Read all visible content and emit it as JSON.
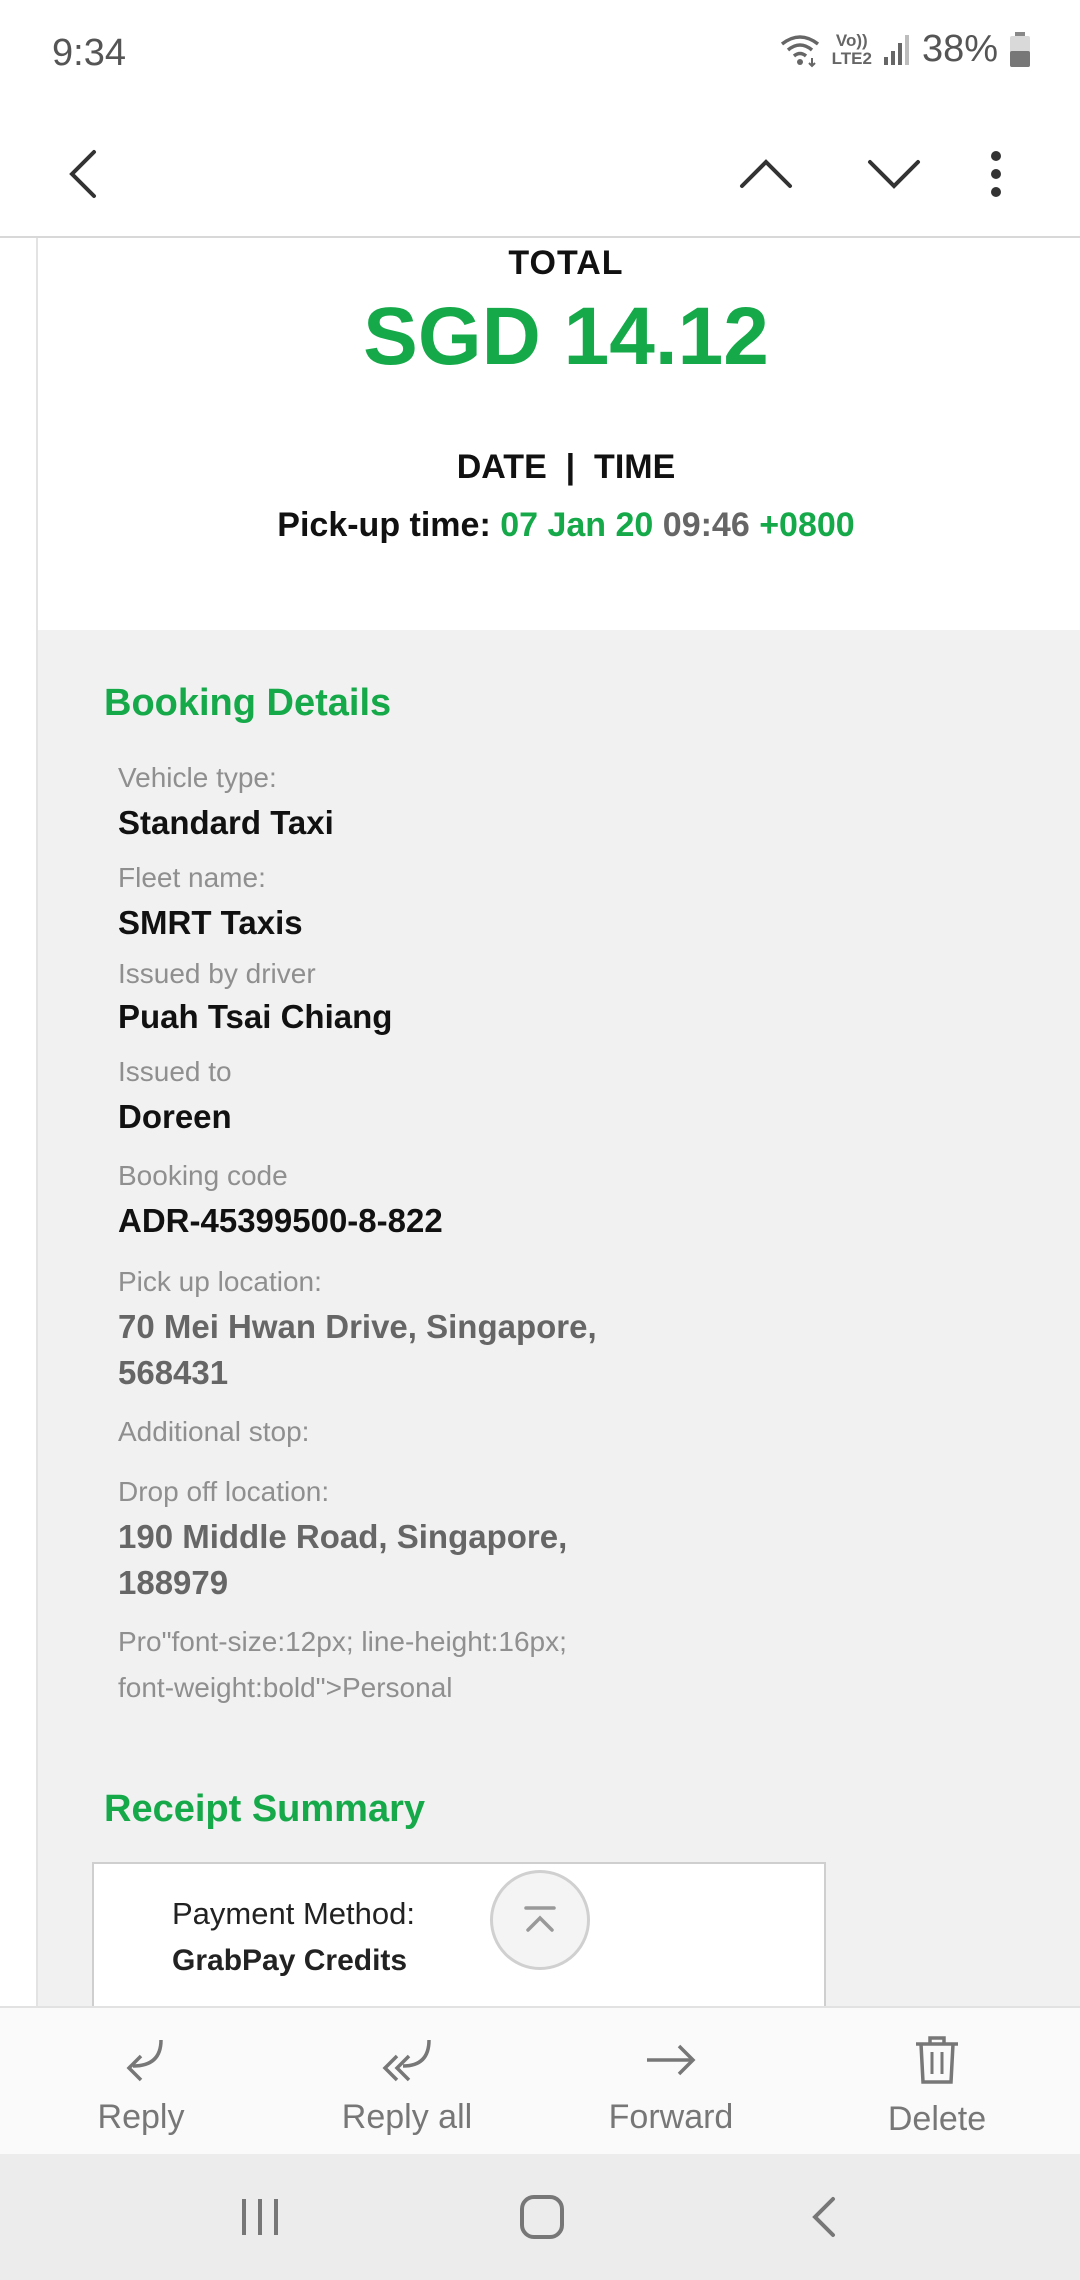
{
  "status_bar": {
    "time": "9:34",
    "network_label": "LTE2",
    "network_top": "Vo))",
    "battery": "38%"
  },
  "app_bar": {
    "icons": [
      "back-arrow-icon",
      "chevron-up-icon",
      "chevron-down-icon",
      "more-vert-icon"
    ]
  },
  "receipt": {
    "total_label": "TOTAL",
    "total_amount": "SGD 14.12",
    "datetime_label": "DATE  |  TIME",
    "pickup_prefix": "Pick-up time: ",
    "pickup_date": "07 Jan 20",
    "pickup_time": " 09:46 ",
    "pickup_tz": "+0800"
  },
  "booking_details": {
    "title": "Booking Details",
    "fields": [
      {
        "label": "Vehicle type:",
        "value": "Standard Taxi"
      },
      {
        "label": "Fleet name:",
        "value": "SMRT Taxis"
      },
      {
        "label": "Issued by driver",
        "value": "Puah Tsai Chiang"
      },
      {
        "label": "Issued to",
        "value": "Doreen"
      },
      {
        "label": "Booking code",
        "value": "ADR-45399500-8-822"
      },
      {
        "label": "Pick up location:",
        "value_line1": "70 Mei Hwan Drive, Singapore,",
        "value_line2": "568431"
      },
      {
        "label": "Additional stop:"
      },
      {
        "label": "Drop off location:",
        "value_line1": "190 Middle Road, Singapore,",
        "value_line2": "188979"
      }
    ],
    "profile_line1": "Pro\"font-size:12px; line-height:16px;",
    "profile_line2": "font-weight:bold\">Personal"
  },
  "receipt_summary": {
    "title": "Receipt Summary",
    "payment_method_label": "Payment Method:",
    "payment_method_value": "GrabPay Credits"
  },
  "actions": [
    {
      "label": "Reply",
      "icon": "reply-icon"
    },
    {
      "label": "Reply all",
      "icon": "reply-all-icon"
    },
    {
      "label": "Forward",
      "icon": "forward-icon"
    },
    {
      "label": "Delete",
      "icon": "trash-icon"
    }
  ],
  "nav_bar": {
    "icons": [
      "recent-apps-icon",
      "home-icon",
      "nav-back-icon"
    ]
  },
  "colors": {
    "accent_green": "#16a94a",
    "panel_grey": "#f1f1f1"
  }
}
